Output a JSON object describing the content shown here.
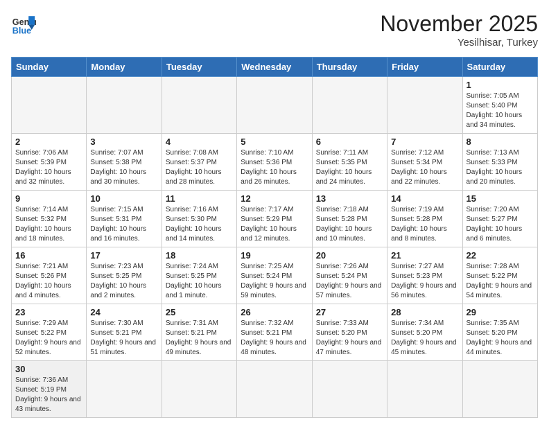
{
  "header": {
    "logo_general": "General",
    "logo_blue": "Blue",
    "month_title": "November 2025",
    "subtitle": "Yesilhisar, Turkey"
  },
  "days_of_week": [
    "Sunday",
    "Monday",
    "Tuesday",
    "Wednesday",
    "Thursday",
    "Friday",
    "Saturday"
  ],
  "weeks": [
    [
      {
        "day": "",
        "info": ""
      },
      {
        "day": "",
        "info": ""
      },
      {
        "day": "",
        "info": ""
      },
      {
        "day": "",
        "info": ""
      },
      {
        "day": "",
        "info": ""
      },
      {
        "day": "",
        "info": ""
      },
      {
        "day": "1",
        "info": "Sunrise: 7:05 AM\nSunset: 5:40 PM\nDaylight: 10 hours and 34 minutes."
      }
    ],
    [
      {
        "day": "2",
        "info": "Sunrise: 7:06 AM\nSunset: 5:39 PM\nDaylight: 10 hours and 32 minutes."
      },
      {
        "day": "3",
        "info": "Sunrise: 7:07 AM\nSunset: 5:38 PM\nDaylight: 10 hours and 30 minutes."
      },
      {
        "day": "4",
        "info": "Sunrise: 7:08 AM\nSunset: 5:37 PM\nDaylight: 10 hours and 28 minutes."
      },
      {
        "day": "5",
        "info": "Sunrise: 7:10 AM\nSunset: 5:36 PM\nDaylight: 10 hours and 26 minutes."
      },
      {
        "day": "6",
        "info": "Sunrise: 7:11 AM\nSunset: 5:35 PM\nDaylight: 10 hours and 24 minutes."
      },
      {
        "day": "7",
        "info": "Sunrise: 7:12 AM\nSunset: 5:34 PM\nDaylight: 10 hours and 22 minutes."
      },
      {
        "day": "8",
        "info": "Sunrise: 7:13 AM\nSunset: 5:33 PM\nDaylight: 10 hours and 20 minutes."
      }
    ],
    [
      {
        "day": "9",
        "info": "Sunrise: 7:14 AM\nSunset: 5:32 PM\nDaylight: 10 hours and 18 minutes."
      },
      {
        "day": "10",
        "info": "Sunrise: 7:15 AM\nSunset: 5:31 PM\nDaylight: 10 hours and 16 minutes."
      },
      {
        "day": "11",
        "info": "Sunrise: 7:16 AM\nSunset: 5:30 PM\nDaylight: 10 hours and 14 minutes."
      },
      {
        "day": "12",
        "info": "Sunrise: 7:17 AM\nSunset: 5:29 PM\nDaylight: 10 hours and 12 minutes."
      },
      {
        "day": "13",
        "info": "Sunrise: 7:18 AM\nSunset: 5:28 PM\nDaylight: 10 hours and 10 minutes."
      },
      {
        "day": "14",
        "info": "Sunrise: 7:19 AM\nSunset: 5:28 PM\nDaylight: 10 hours and 8 minutes."
      },
      {
        "day": "15",
        "info": "Sunrise: 7:20 AM\nSunset: 5:27 PM\nDaylight: 10 hours and 6 minutes."
      }
    ],
    [
      {
        "day": "16",
        "info": "Sunrise: 7:21 AM\nSunset: 5:26 PM\nDaylight: 10 hours and 4 minutes."
      },
      {
        "day": "17",
        "info": "Sunrise: 7:23 AM\nSunset: 5:25 PM\nDaylight: 10 hours and 2 minutes."
      },
      {
        "day": "18",
        "info": "Sunrise: 7:24 AM\nSunset: 5:25 PM\nDaylight: 10 hours and 1 minute."
      },
      {
        "day": "19",
        "info": "Sunrise: 7:25 AM\nSunset: 5:24 PM\nDaylight: 9 hours and 59 minutes."
      },
      {
        "day": "20",
        "info": "Sunrise: 7:26 AM\nSunset: 5:24 PM\nDaylight: 9 hours and 57 minutes."
      },
      {
        "day": "21",
        "info": "Sunrise: 7:27 AM\nSunset: 5:23 PM\nDaylight: 9 hours and 56 minutes."
      },
      {
        "day": "22",
        "info": "Sunrise: 7:28 AM\nSunset: 5:22 PM\nDaylight: 9 hours and 54 minutes."
      }
    ],
    [
      {
        "day": "23",
        "info": "Sunrise: 7:29 AM\nSunset: 5:22 PM\nDaylight: 9 hours and 52 minutes."
      },
      {
        "day": "24",
        "info": "Sunrise: 7:30 AM\nSunset: 5:21 PM\nDaylight: 9 hours and 51 minutes."
      },
      {
        "day": "25",
        "info": "Sunrise: 7:31 AM\nSunset: 5:21 PM\nDaylight: 9 hours and 49 minutes."
      },
      {
        "day": "26",
        "info": "Sunrise: 7:32 AM\nSunset: 5:21 PM\nDaylight: 9 hours and 48 minutes."
      },
      {
        "day": "27",
        "info": "Sunrise: 7:33 AM\nSunset: 5:20 PM\nDaylight: 9 hours and 47 minutes."
      },
      {
        "day": "28",
        "info": "Sunrise: 7:34 AM\nSunset: 5:20 PM\nDaylight: 9 hours and 45 minutes."
      },
      {
        "day": "29",
        "info": "Sunrise: 7:35 AM\nSunset: 5:20 PM\nDaylight: 9 hours and 44 minutes."
      }
    ],
    [
      {
        "day": "30",
        "info": "Sunrise: 7:36 AM\nSunset: 5:19 PM\nDaylight: 9 hours and 43 minutes."
      },
      {
        "day": "",
        "info": ""
      },
      {
        "day": "",
        "info": ""
      },
      {
        "day": "",
        "info": ""
      },
      {
        "day": "",
        "info": ""
      },
      {
        "day": "",
        "info": ""
      },
      {
        "day": "",
        "info": ""
      }
    ]
  ]
}
